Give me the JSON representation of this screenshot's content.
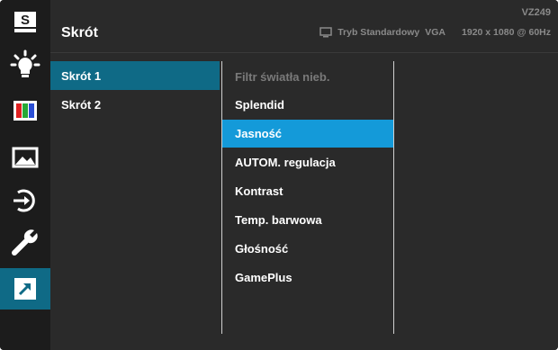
{
  "header": {
    "title": "Skrót",
    "model": "VZ249",
    "status": {
      "monitor_icon": "monitor-icon",
      "mode": "Tryb Standardowy",
      "input": "VGA",
      "resolution": "1920 x 1080 @ 60Hz"
    }
  },
  "rail": {
    "items": [
      {
        "name": "splendid-icon",
        "label": "S"
      },
      {
        "name": "blue-light-icon"
      },
      {
        "name": "color-icon"
      },
      {
        "name": "image-icon"
      },
      {
        "name": "input-select-icon"
      },
      {
        "name": "system-setup-icon"
      },
      {
        "name": "shortcut-icon",
        "active": true
      }
    ]
  },
  "submenu": {
    "items": [
      {
        "label": "Skrót 1",
        "selected": true
      },
      {
        "label": "Skrót 2"
      }
    ]
  },
  "options": {
    "items": [
      {
        "label": "Filtr światła nieb.",
        "disabled": true
      },
      {
        "label": "Splendid"
      },
      {
        "label": "Jasność",
        "selected": true
      },
      {
        "label": "AUTOM. regulacja"
      },
      {
        "label": "Kontrast"
      },
      {
        "label": "Temp. barwowa"
      },
      {
        "label": "Głośność"
      },
      {
        "label": "GamePlus"
      }
    ]
  },
  "colors": {
    "active_rail": "#0f6a86",
    "selected_option": "#149ad9",
    "background": "#2a2a2a"
  }
}
